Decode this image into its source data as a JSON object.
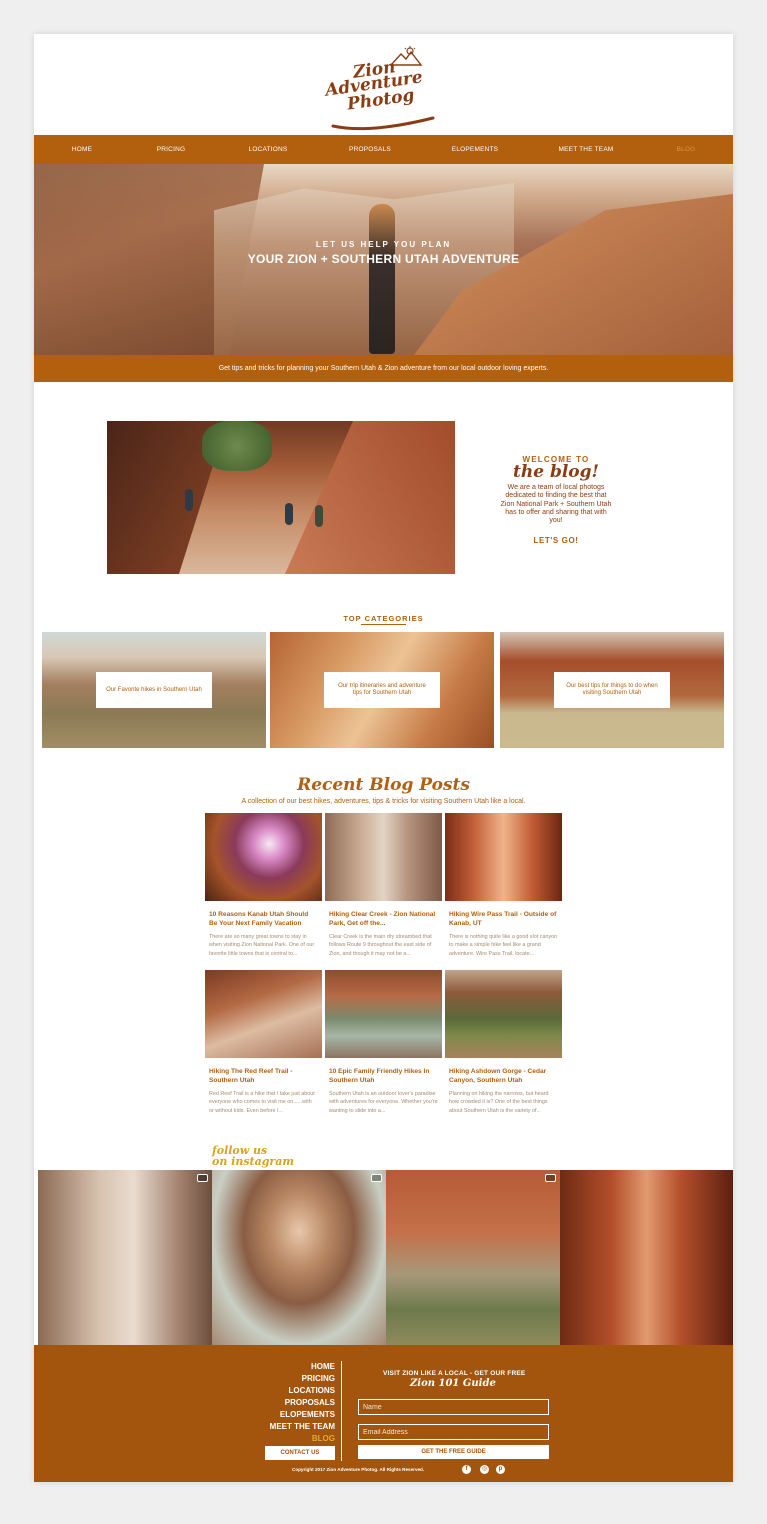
{
  "logo": {
    "line1": "Zion",
    "line2": "Adventure",
    "line3": "Photog"
  },
  "nav": {
    "items": [
      {
        "label": "HOME"
      },
      {
        "label": "PRICING"
      },
      {
        "label": "LOCATIONS"
      },
      {
        "label": "PROPOSALS"
      },
      {
        "label": "ELOPEMENTS"
      },
      {
        "label": "MEET THE TEAM"
      },
      {
        "label": "BLOG"
      }
    ],
    "active": "BLOG"
  },
  "hero": {
    "subtitle": "LET US HELP YOU PLAN",
    "title": "YOUR ZION + SOUTHERN UTAH ADVENTURE"
  },
  "tip_bar": "Get tips and tricks for planning your Southern Utah & Zion adventure from our local outdoor loving experts.",
  "welcome": {
    "line1": "WELCOME TO",
    "line2": "the blog!",
    "body": "We are a team of local photogs dedicated to finding the best that Zion National Park + Southern Utah has to offer and sharing that with you!",
    "cta": "LET'S GO!"
  },
  "categories": {
    "title": "TOP CATEGORIES",
    "items": [
      {
        "label": "Our Favorite hikes in Southern Utah"
      },
      {
        "label": "Our trip itineraries and adventure tips for Southern Utah"
      },
      {
        "label": "Our best tips for things to do when visiting Southern Utah"
      }
    ]
  },
  "recent": {
    "title": "Recent Blog Posts",
    "subtitle": "A collection of our best hikes, adventures, tips & tricks for visiting Southern Utah like a local.",
    "posts": [
      {
        "title": "10 Reasons Kanab Utah Should Be Your Next Family Vacation",
        "excerpt": "There are so many great towns to stay in when visiting Zion National Park. One of our favorite little towns that is central to..."
      },
      {
        "title": "Hiking Clear Creek - Zion National Park, Get off the...",
        "excerpt": "Clear Creek is the main dry streambed that follows Route 9 throughout the east side of Zion, and though it may not be a..."
      },
      {
        "title": "Hiking Wire Pass Trail - Outside of Kanab, UT",
        "excerpt": "There is nothing quite like a good slot canyon to make a simple hike feel like a grand adventure. Wire Pass Trail, locate..."
      },
      {
        "title": "Hiking The Red Reef Trail - Southern Utah",
        "excerpt": "Red Reef Trail is a hike that I take just about everyone who comes to visit me on......with or without kids. Even before I..."
      },
      {
        "title": "10 Epic Family Friendly Hikes In Southern Utah",
        "excerpt": "Southern Utah is an outdoor lover's paradise with adventures for everyone. Whether you're wanting to slide into a..."
      },
      {
        "title": "Hiking Ashdown Gorge - Cedar Canyon, Southern Utah",
        "excerpt": "Planning on hiking the narrows, but heard how crowded it is? One of the best things about Southern Utah is the variety of..."
      }
    ]
  },
  "instagram": {
    "line1": "follow us",
    "line2": "on instagram"
  },
  "footer": {
    "links": [
      {
        "label": "HOME"
      },
      {
        "label": "PRICING"
      },
      {
        "label": "LOCATIONS"
      },
      {
        "label": "PROPOSALS"
      },
      {
        "label": "ELOPEMENTS"
      },
      {
        "label": "MEET THE TEAM"
      },
      {
        "label": "BLOG"
      }
    ],
    "contact_button": "CONTACT US",
    "guide_top": "VISIT ZION LIKE A LOCAL - GET OUR FREE",
    "guide_title": "Zion 101 Guide",
    "name_placeholder": "Name",
    "email_placeholder": "Email Address",
    "guide_button": "GET THE FREE GUIDE",
    "copyright": "Copyright 2017 Zion Adventure Photog. All Rights Reserved.",
    "social": [
      "facebook-icon",
      "instagram-icon",
      "pinterest-icon"
    ]
  },
  "colors": {
    "accent": "#b25f0e",
    "footer": "#a4550d",
    "brand_dark": "#8a3d12",
    "gold": "#d9a321"
  }
}
